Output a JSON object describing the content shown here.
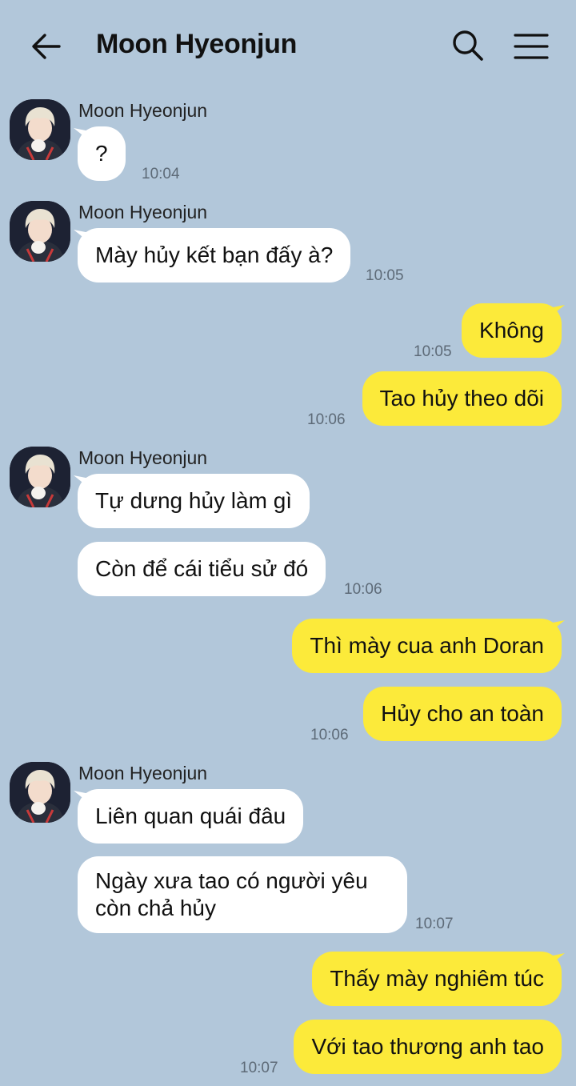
{
  "header": {
    "title": "Moon Hyeonjun",
    "back_icon": "arrow-left-icon",
    "search_icon": "search-icon",
    "menu_icon": "hamburger-menu-icon"
  },
  "colors": {
    "background": "#b2c7da",
    "incoming_bubble": "#ffffff",
    "outgoing_bubble": "#fcea3a"
  },
  "messages": [
    {
      "direction": "incoming",
      "sender": "Moon Hyeonjun",
      "text": "?",
      "time": "10:04"
    },
    {
      "direction": "incoming",
      "sender": "Moon Hyeonjun",
      "text": "Mày hủy kết bạn đấy à?",
      "time": "10:05"
    },
    {
      "direction": "outgoing",
      "text": "Không",
      "time": "10:05"
    },
    {
      "direction": "outgoing",
      "text": "Tao hủy theo dõi",
      "time": "10:06"
    },
    {
      "direction": "incoming",
      "sender": "Moon Hyeonjun",
      "text": "Tự dưng hủy làm gì"
    },
    {
      "direction": "incoming",
      "text": "Còn để cái tiểu sử đó",
      "time": "10:06"
    },
    {
      "direction": "outgoing",
      "text": "Thì mày cua anh Doran"
    },
    {
      "direction": "outgoing",
      "text": "Hủy cho an toàn",
      "time": "10:06"
    },
    {
      "direction": "incoming",
      "sender": "Moon Hyeonjun",
      "text": "Liên quan quái đâu"
    },
    {
      "direction": "incoming",
      "text": "Ngày xưa tao có người yêu còn chả hủy",
      "time": "10:07"
    },
    {
      "direction": "outgoing",
      "text": "Thấy mày nghiêm túc"
    },
    {
      "direction": "outgoing",
      "text": "Với tao thương anh tao",
      "time": "10:07"
    }
  ]
}
